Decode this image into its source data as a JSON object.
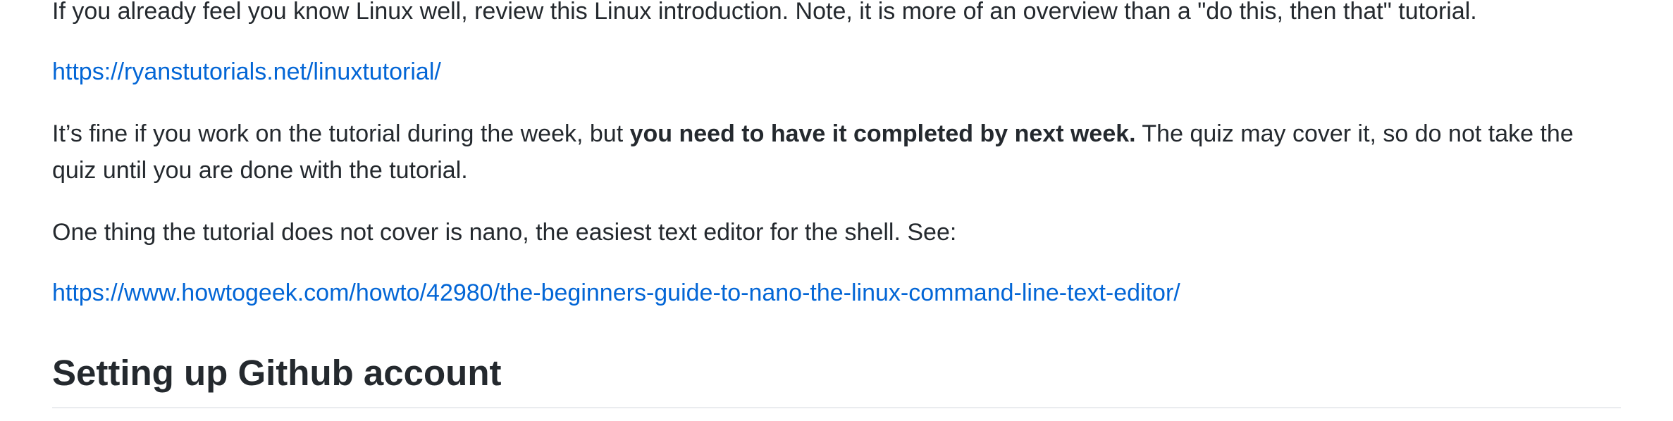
{
  "paragraphs": {
    "intro": "If you already feel you know Linux well, review this Linux introduction. Note, it is more of an overview than a \"do this, then that\" tutorial.",
    "link1": "https://ryanstutorials.net/linuxtutorial/",
    "deadline": {
      "before": "It’s fine if you work on the tutorial during the week, but ",
      "bold": "you need to have it completed by next week.",
      "after": " The quiz may cover it, so do not take the quiz until you are done with the tutorial."
    },
    "nano": "One thing the tutorial does not cover is nano, the easiest text editor for the shell. See:",
    "link2": "https://www.howtogeek.com/howto/42980/the-beginners-guide-to-nano-the-linux-command-line-text-editor/"
  },
  "heading": {
    "text": "Setting up Github account"
  },
  "colors": {
    "text": "#24292e",
    "link": "#0366d6",
    "rule": "#eaecef"
  }
}
